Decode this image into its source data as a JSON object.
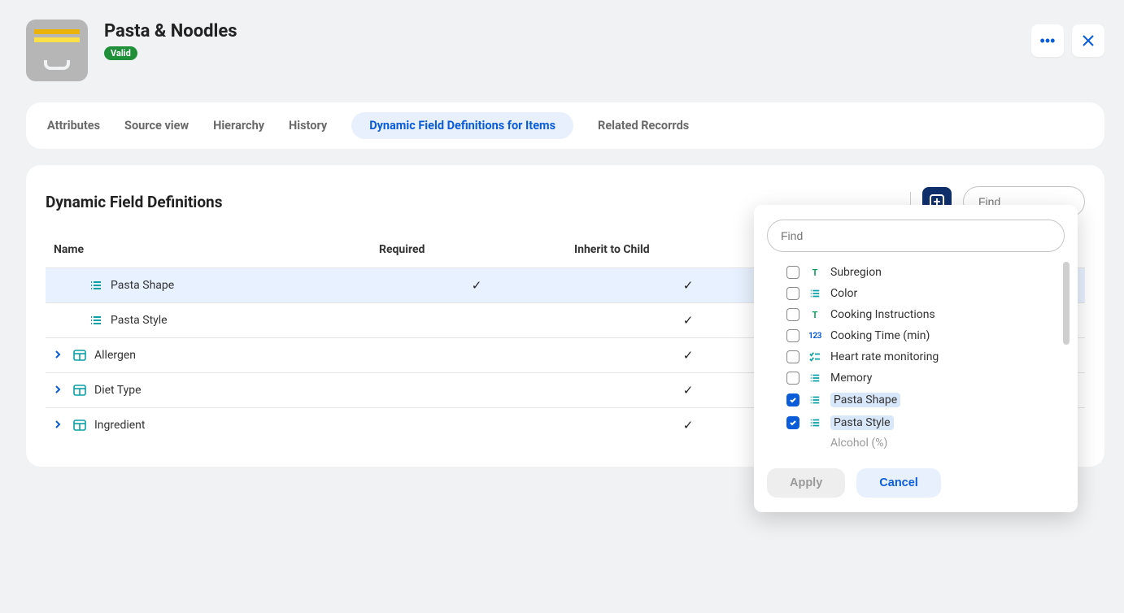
{
  "header": {
    "title": "Pasta & Noodles",
    "status_label": "Valid"
  },
  "tabs": [
    {
      "label": "Attributes",
      "active": false
    },
    {
      "label": "Source view",
      "active": false
    },
    {
      "label": "Hierarchy",
      "active": false
    },
    {
      "label": "History",
      "active": false
    },
    {
      "label": "Dynamic Field Definitions for Items",
      "active": true
    },
    {
      "label": "Related Recorrds",
      "active": false
    }
  ],
  "panel": {
    "title": "Dynamic Field Definitions",
    "find_placeholder": "Find",
    "columns": {
      "name": "Name",
      "required": "Required",
      "inherit": "Inherit to Child"
    },
    "rows": [
      {
        "name": "Pasta Shape",
        "icon": "list",
        "expandable": false,
        "indent": true,
        "required": true,
        "inherit": true,
        "selected": true
      },
      {
        "name": "Pasta Style",
        "icon": "list",
        "expandable": false,
        "indent": true,
        "required": false,
        "inherit": true,
        "selected": false
      },
      {
        "name": "Allergen",
        "icon": "lookup",
        "expandable": true,
        "indent": false,
        "required": false,
        "inherit": true,
        "selected": false
      },
      {
        "name": "Diet Type",
        "icon": "lookup",
        "expandable": true,
        "indent": false,
        "required": false,
        "inherit": true,
        "selected": false
      },
      {
        "name": "Ingredient",
        "icon": "lookup",
        "expandable": true,
        "indent": false,
        "required": false,
        "inherit": true,
        "selected": false
      }
    ]
  },
  "dropdown": {
    "find_placeholder": "Find",
    "apply_label": "Apply",
    "cancel_label": "Cancel",
    "items": [
      {
        "label": "Subregion",
        "icon": "text",
        "checked": false,
        "hl": false
      },
      {
        "label": "Color",
        "icon": "list",
        "checked": false,
        "hl": false
      },
      {
        "label": "Cooking Instructions",
        "icon": "text",
        "checked": false,
        "hl": false
      },
      {
        "label": "Cooking Time (min)",
        "icon": "number",
        "checked": false,
        "hl": false
      },
      {
        "label": "Heart rate monitoring",
        "icon": "check",
        "checked": false,
        "hl": false
      },
      {
        "label": "Memory",
        "icon": "list",
        "checked": false,
        "hl": false
      },
      {
        "label": "Pasta Shape",
        "icon": "list",
        "checked": true,
        "hl": true
      },
      {
        "label": "Pasta Style",
        "icon": "list",
        "checked": true,
        "hl": true
      },
      {
        "label": "Alcohol (%)",
        "icon": "number",
        "checked": false,
        "hl": false,
        "greyed": true
      }
    ]
  }
}
